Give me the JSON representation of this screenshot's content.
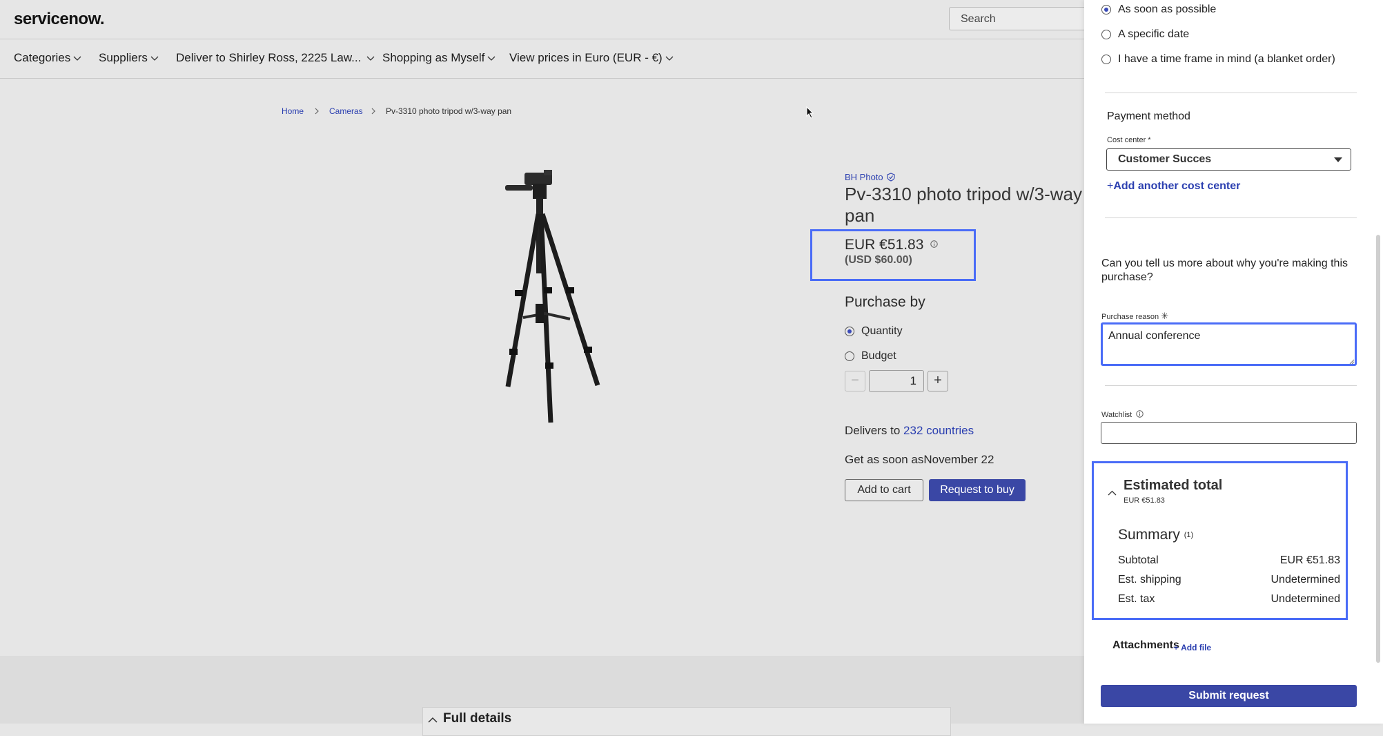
{
  "header": {
    "logo": "servicenow.",
    "search_placeholder": "Search"
  },
  "nav": {
    "categories": "Categories",
    "suppliers": "Suppliers",
    "deliver_to": "Deliver to Shirley Ross, 2225 Law...",
    "shopping_as": "Shopping as Myself",
    "view_prices": "View prices in Euro (EUR - €)"
  },
  "breadcrumb": {
    "home": "Home",
    "cameras": "Cameras",
    "current": "Pv-3310 photo tripod w/3-way pan"
  },
  "product": {
    "vendor": "BH Photo",
    "title": "Pv-3310 photo tripod w/3-way pan",
    "price": "EUR €51.83",
    "price_usd": "(USD $60.00)",
    "purchase_by": "Purchase by",
    "option_quantity": "Quantity",
    "option_budget": "Budget",
    "quantity_value": "1",
    "delivers_prefix": "Delivers to",
    "delivers_link": "232 countries",
    "get_asap": "Get as soon asNovember 22",
    "add_to_cart": "Add to cart",
    "request_to_buy": "Request to buy",
    "full_details": "Full details"
  },
  "panel": {
    "timing_options": [
      "As soon as possible",
      "A specific date",
      "I have a time frame in mind (a blanket order)"
    ],
    "payment_method": "Payment method",
    "cost_center_label": "Cost center *",
    "cost_center_value": "Customer Succes",
    "add_cost_center": "Add another cost center",
    "question": "Can you tell us more about why you're making this purchase?",
    "purchase_reason_label": "Purchase reason",
    "purchase_reason_value": "Annual conference",
    "watchlist_label": "Watchlist",
    "estimated_total": "Estimated total",
    "estimated_total_value": "EUR €51.83",
    "summary": "Summary",
    "summary_count": "(1)",
    "subtotal_label": "Subtotal",
    "subtotal_value": "EUR €51.83",
    "shipping_label": "Est. shipping",
    "shipping_value": "Undetermined",
    "tax_label": "Est. tax",
    "tax_value": "Undetermined",
    "attachments": "Attachments",
    "add_file": "Add file",
    "submit": "Submit request"
  },
  "colors": {
    "accent": "#3a47a5",
    "link": "#2b3fb0",
    "highlight": "#4a6cf7"
  }
}
